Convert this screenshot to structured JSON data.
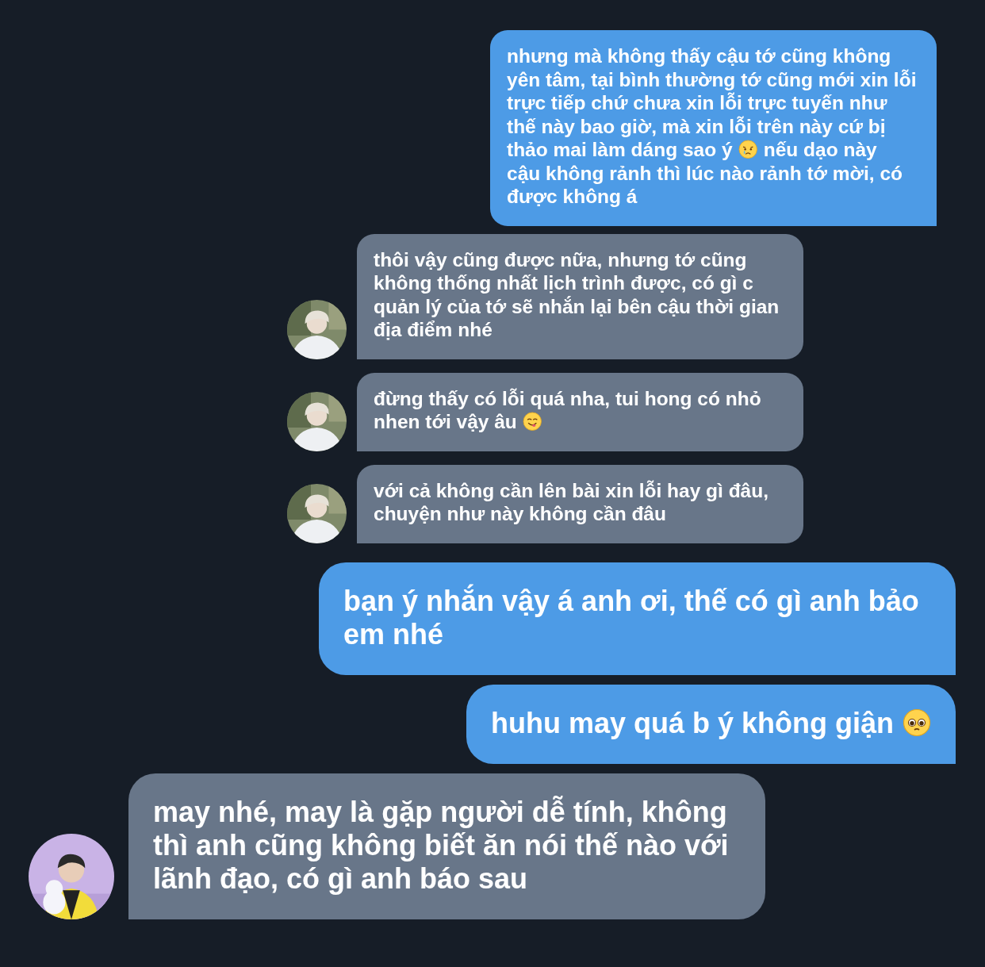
{
  "messages": [
    {
      "kind": "sent",
      "large": false,
      "rows": [
        {
          "parts": [
            {
              "kind": "text",
              "text": "nhưng mà không thấy cậu tớ cũng không yên tâm, tại bình thường tớ cũng mới xin lỗi trực tiếp chứ chưa xin lỗi trực tuyến như thế này bao giờ, mà xin lỗi trên này cứ bị"
            }
          ]
        },
        {
          "parts": [
            {
              "kind": "text",
              "text": "thảo mai làm dáng sao ý"
            },
            {
              "kind": "crying"
            },
            {
              "kind": "text",
              "text": "nếu dạo này"
            }
          ]
        },
        {
          "parts": [
            {
              "kind": "text",
              "text": "cậu không rảnh thì lúc nào rảnh tớ mời, có được không á"
            }
          ]
        }
      ]
    },
    {
      "kind": "received",
      "large": false,
      "rows": [
        {
          "parts": [
            {
              "kind": "text",
              "text": "thôi vậy cũng được nữa, nhưng tớ cũng không thống nhất lịch trình được, có gì c quản lý của tớ sẽ nhắn lại bên cậu thời gian địa điểm nhé"
            }
          ]
        }
      ]
    },
    {
      "kind": "received",
      "large": false,
      "rows": [
        {
          "parts": [
            {
              "kind": "text",
              "text": "đừng thấy có lỗi quá nha, tui hong có nhỏ"
            }
          ]
        },
        {
          "parts": [
            {
              "kind": "text",
              "text": "nhen tới vậy âu"
            },
            {
              "kind": "tongue"
            }
          ]
        }
      ]
    },
    {
      "kind": "received",
      "large": false,
      "rows": [
        {
          "parts": [
            {
              "kind": "text",
              "text": "với cả không cần lên bài xin lỗi hay gì đâu, chuyện như này không cần đâu"
            }
          ]
        }
      ]
    },
    {
      "kind": "sent",
      "large": true,
      "rows": [
        {
          "parts": [
            {
              "kind": "text",
              "text": "bạn ý nhắn vậy á anh ơi, thế có gì anh bảo em nhé"
            }
          ]
        }
      ]
    },
    {
      "kind": "sent",
      "large": true,
      "rows": [
        {
          "parts": [
            {
              "kind": "text",
              "text": "huhu may quá b ý không giận"
            },
            {
              "kind": "pleading"
            }
          ]
        }
      ]
    },
    {
      "kind": "received",
      "large": true,
      "rows": [
        {
          "parts": [
            {
              "kind": "text",
              "text": "may nhé, may là gặp người dễ tính, không thì anh cũng không biết ăn nói thế nào với lãnh đạo, có gì anh báo sau"
            }
          ]
        }
      ]
    }
  ]
}
